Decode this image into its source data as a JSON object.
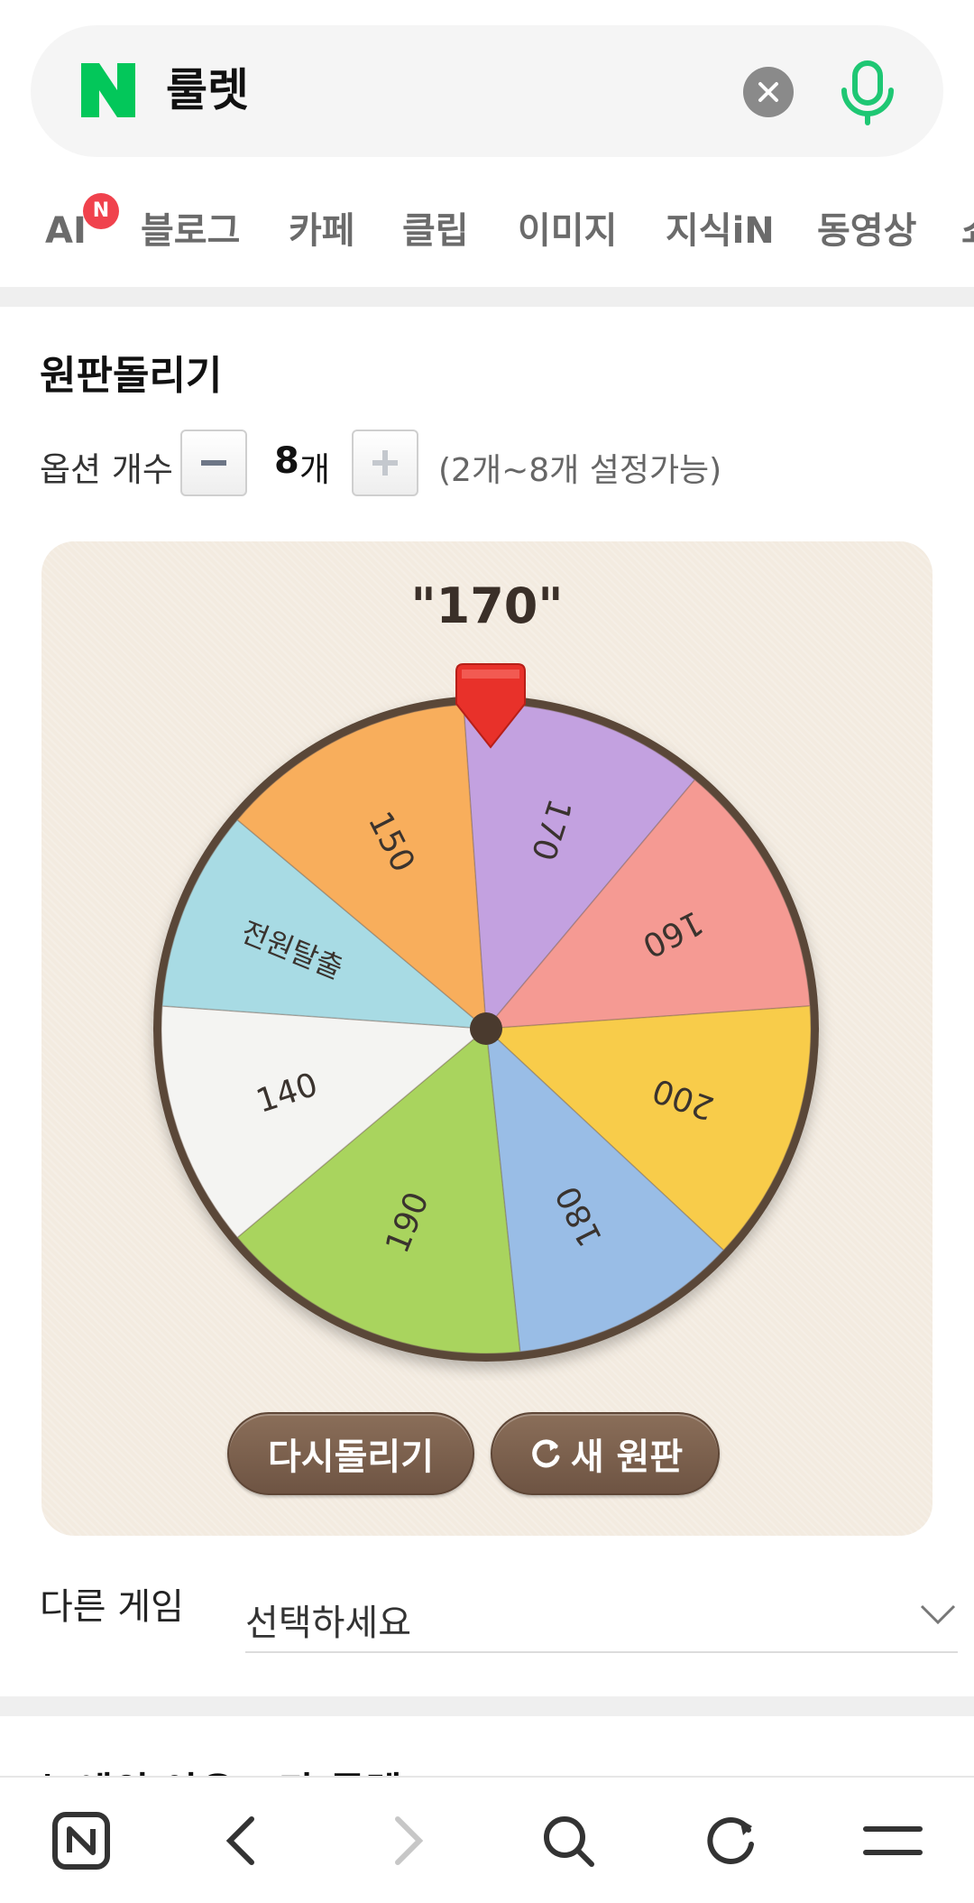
{
  "search": {
    "query": "룰렛"
  },
  "tabs": [
    "AI",
    "블로그",
    "카페",
    "클립",
    "이미지",
    "지식iN",
    "동영상",
    "쇼"
  ],
  "ai_badge": "N",
  "roulette": {
    "title": "원판돌리기",
    "option_label": "옵션 개수",
    "count": "8",
    "count_unit": "개",
    "range_note": "(2개~8개 설정가능)",
    "result": "\"170\"",
    "segments": [
      {
        "label": "170",
        "color": "#c3a1e0"
      },
      {
        "label": "160",
        "color": "#f59a93"
      },
      {
        "label": "200",
        "color": "#f8cc4a"
      },
      {
        "label": "180",
        "color": "#99bde6"
      },
      {
        "label": "190",
        "color": "#a9d45e"
      },
      {
        "label": "140",
        "color": "#f4f4f2"
      },
      {
        "label": "전원탈출",
        "color": "#a8dbe4"
      },
      {
        "label": "150",
        "color": "#f8ae5c"
      }
    ],
    "spin_again": "다시돌리기",
    "new_wheel": "새 원판"
  },
  "other_game": {
    "label": "다른 게임",
    "placeholder": "선택하세요"
  },
  "next_section": {
    "title": "누에의 아유 · 타 룰렛"
  },
  "colors": {
    "naver_green": "#03c75a",
    "mic_green": "#1ec773",
    "badge_red": "#f0424d",
    "button_brown": "#7a604d"
  },
  "bottom_nav": [
    "naver-home-icon",
    "back-icon",
    "forward-icon",
    "search-icon",
    "refresh-icon",
    "menu-icon"
  ]
}
